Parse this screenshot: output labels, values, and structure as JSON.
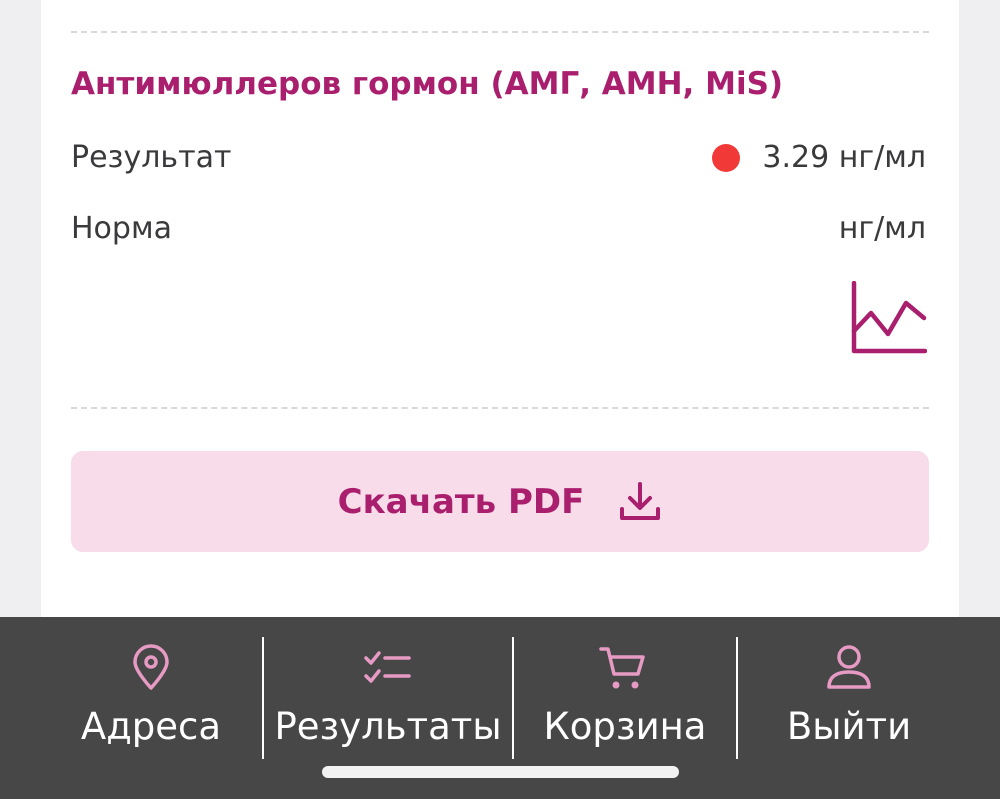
{
  "result": {
    "test_name": "Антимюллеров гормон (АМГ, AMH, MiS)",
    "result_label": "Результат",
    "result_value": "3.29 нг/мл",
    "result_status_color": "#f13a38",
    "norm_label": "Норма",
    "norm_value": "нг/мл",
    "chart_icon": "line-chart-icon"
  },
  "pdf_button": {
    "label": "Скачать PDF",
    "icon": "download-icon"
  },
  "colors": {
    "accent": "#a91f6d",
    "accent_light": "#f8dce9",
    "tabbar_bg": "#474747",
    "tab_icon": "#e79bc4"
  },
  "tabbar": {
    "items": [
      {
        "label": "Адреса",
        "icon": "location-pin-icon"
      },
      {
        "label": "Результаты",
        "icon": "checklist-icon"
      },
      {
        "label": "Корзина",
        "icon": "cart-icon"
      },
      {
        "label": "Выйти",
        "icon": "user-icon"
      }
    ]
  }
}
